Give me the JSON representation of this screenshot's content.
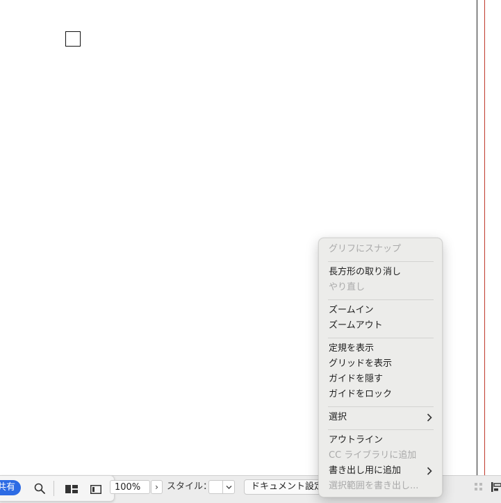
{
  "toolbar": {
    "share_label": "共有",
    "zoom_value": "100%",
    "zoom_stepper_glyph": "›",
    "style_label": "スタイル：",
    "style_value": "",
    "doc_settings_label": "ドキュメント設定"
  },
  "context_menu": {
    "items": [
      {
        "label": "グリフにスナップ",
        "enabled": false
      },
      {
        "label": "長方形の取り消し",
        "enabled": true
      },
      {
        "label": "やり直し",
        "enabled": false
      },
      {
        "label": "ズームイン",
        "enabled": true
      },
      {
        "label": "ズームアウト",
        "enabled": true
      },
      {
        "label": "定規を表示",
        "enabled": true
      },
      {
        "label": "グリッドを表示",
        "enabled": true
      },
      {
        "label": "ガイドを隠す",
        "enabled": true
      },
      {
        "label": "ガイドをロック",
        "enabled": true
      },
      {
        "label": "選択",
        "enabled": true,
        "submenu": true
      },
      {
        "label": "アウトライン",
        "enabled": true
      },
      {
        "label": "CC ライブラリに追加",
        "enabled": false
      },
      {
        "label": "書き出し用に追加",
        "enabled": true,
        "submenu": true
      },
      {
        "label": "選択範囲を書き出し...",
        "enabled": false
      }
    ]
  },
  "colors": {
    "accent": "#2d6be4",
    "guide_red": "#c0392b",
    "menu_bg": "#ececea",
    "disabled_text": "#a9a9a9"
  },
  "icons": {
    "search": "search-icon",
    "layout": "layout-icon",
    "panel": "panel-icon",
    "grid": "grid-icon",
    "align": "align-icon",
    "submenu": "chevron-right-icon"
  }
}
